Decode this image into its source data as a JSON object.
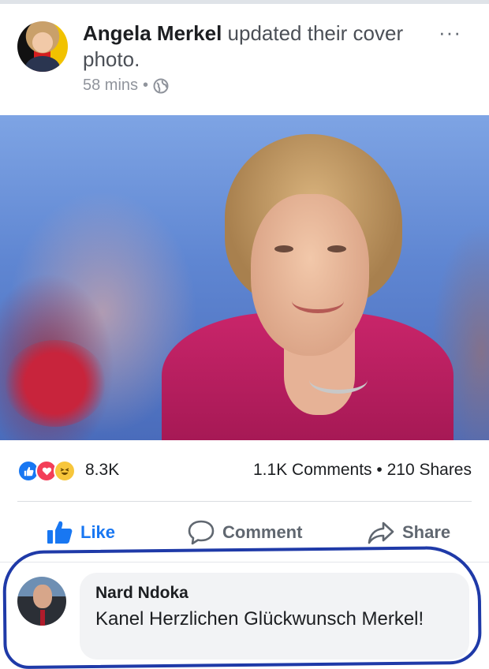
{
  "post": {
    "author": "Angela Merkel",
    "action": " updated their cover photo.",
    "time": "58 mins",
    "separator": "•",
    "privacy_icon": "globe-icon",
    "more_icon": "more-options-icon",
    "more_text": "···"
  },
  "stats": {
    "reaction_icons": [
      "like-reaction-icon",
      "love-reaction-icon",
      "haha-reaction-icon"
    ],
    "reactions_count": "8.3K",
    "comments_shares": "1.1K Comments • 210 Shares"
  },
  "actions": {
    "like": "Like",
    "comment": "Comment",
    "share": "Share"
  },
  "comment": {
    "author": "Nard Ndoka",
    "text": "Kanel Herzlichen Glückwunsch Merkel!"
  },
  "colors": {
    "link_blue": "#1877f2",
    "annotation_blue": "#1f3aa8",
    "text_gray": "#606770"
  }
}
